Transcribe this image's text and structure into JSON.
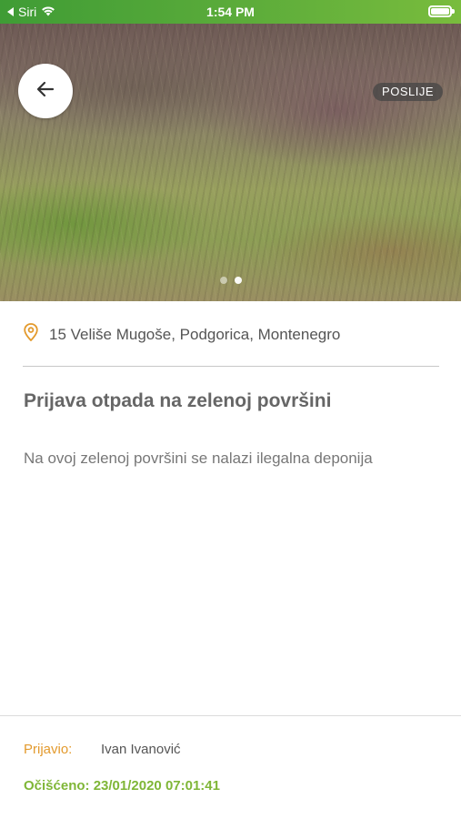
{
  "status_bar": {
    "back_app": "Siri",
    "time": "1:54 PM"
  },
  "photo": {
    "badge": "POSLIJE",
    "pages": 2,
    "active_page": 2
  },
  "report": {
    "location": "15 Veliše Mugoše, Podgorica, Montenegro",
    "title": "Prijava otpada na zelenoj površini",
    "description": "Na ovoj zelenoj površini se nalazi ilegalna deponija"
  },
  "footer": {
    "reporter_label": "Prijavio:",
    "reporter_name": "Ivan Ivanović",
    "cleaned_label": "Očišćeno:",
    "cleaned_date": "23/01/2020 07:01:41"
  },
  "colors": {
    "status_bar": "#5aab3a",
    "accent_orange": "#e39a2d",
    "accent_green": "#7fb637",
    "text_dark": "#555555"
  },
  "icons": [
    "back-to-app-icon",
    "wifi-icon",
    "battery-icon",
    "arrow-left-icon",
    "location-pin-icon"
  ]
}
